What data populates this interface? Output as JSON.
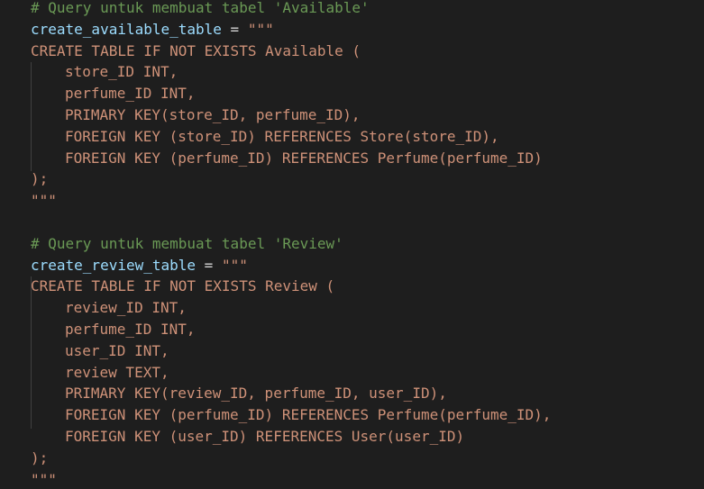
{
  "colors": {
    "background": "#1e1e1e",
    "comment": "#6a9955",
    "variable": "#9cdcfe",
    "operator": "#d4d4d4",
    "string": "#ce9178"
  },
  "code": {
    "available_comment": "# Query untuk membuat tabel 'Available'",
    "available_var": "create_available_table",
    "assign": " = ",
    "open_quotes": "\"\"\"",
    "available_lines": [
      "CREATE TABLE IF NOT EXISTS Available (",
      "store_ID INT,",
      "perfume_ID INT,",
      "PRIMARY KEY(store_ID, perfume_ID),",
      "FOREIGN KEY (store_ID) REFERENCES Store(store_ID),",
      "FOREIGN KEY (perfume_ID) REFERENCES Perfume(perfume_ID)",
      ");",
      "\"\"\""
    ],
    "review_comment": "# Query untuk membuat tabel 'Review'",
    "review_var": "create_review_table",
    "review_lines": [
      "CREATE TABLE IF NOT EXISTS Review (",
      "review_ID INT,",
      "perfume_ID INT,",
      "user_ID INT,",
      "review TEXT,",
      "PRIMARY KEY(review_ID, perfume_ID, user_ID),",
      "FOREIGN KEY (perfume_ID) REFERENCES Perfume(perfume_ID),",
      "FOREIGN KEY (user_ID) REFERENCES User(user_ID)",
      ");",
      "\"\"\""
    ]
  }
}
